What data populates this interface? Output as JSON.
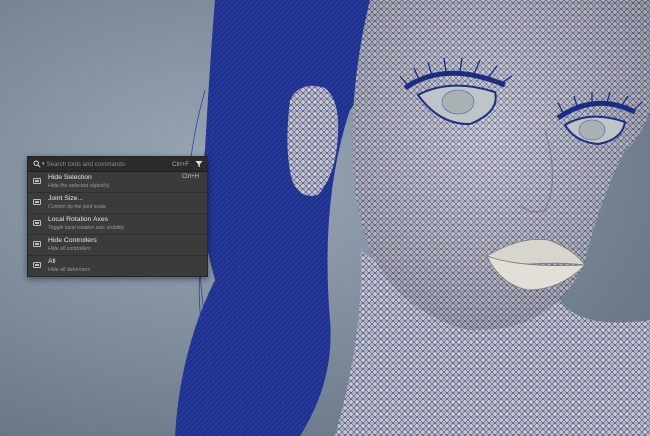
{
  "search": {
    "placeholder": "Search tools and commands",
    "shortcut": "Ctrl+F"
  },
  "results": [
    {
      "title": "Hide Selection",
      "description": "Hide the selected object(s)",
      "hotkey": "Ctrl+H"
    },
    {
      "title": "Joint Size...",
      "description": "Custom tip the joint scale",
      "hotkey": ""
    },
    {
      "title": "Local Rotation Axes",
      "description": "Toggle local rotation axis visibility",
      "hotkey": ""
    },
    {
      "title": "Hide Controllers",
      "description": "Hide all controllers",
      "hotkey": ""
    },
    {
      "title": "All",
      "description": "Hide all deformers",
      "hotkey": ""
    }
  ],
  "colors": {
    "wireframe": "#26378c",
    "mesh": "#c9c5bf",
    "background": "#8592a2"
  },
  "icons": {
    "search": "magnifier-icon",
    "filter": "funnel-icon",
    "item": "menu-command-icon"
  }
}
